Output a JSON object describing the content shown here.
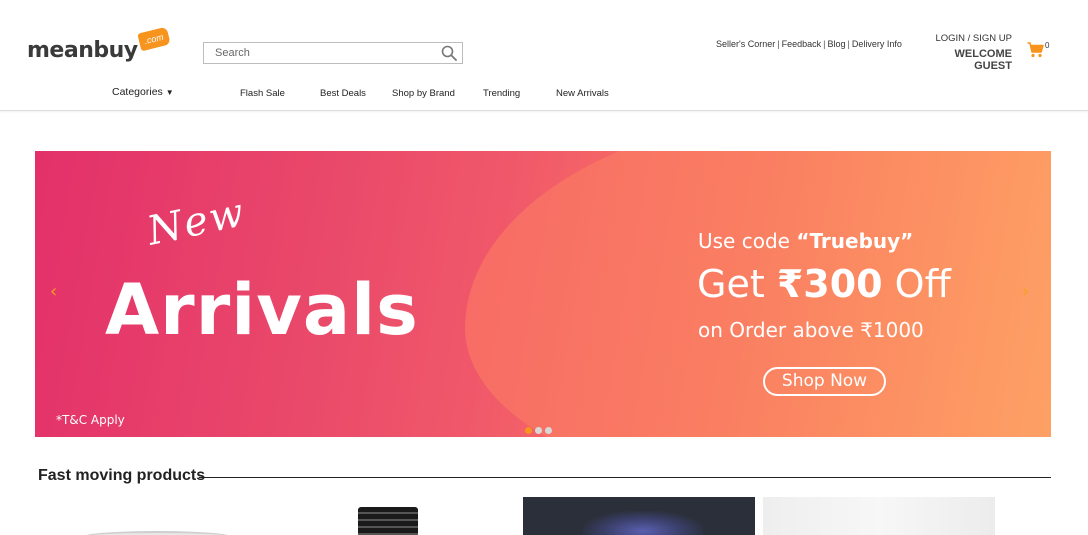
{
  "header": {
    "logo": {
      "word": "meanbuy",
      "tag": ".com"
    },
    "search": {
      "placeholder": "Search"
    },
    "top_links": [
      "Seller's Corner",
      "Feedback",
      "Blog",
      "Delivery Info"
    ],
    "login": {
      "link": "LOGIN / SIGN UP",
      "welcome": "WELCOME GUEST"
    },
    "cart": {
      "count": "0"
    }
  },
  "nav": {
    "categories": "Categories",
    "items": [
      "Flash Sale",
      "Best Deals",
      "Shop by Brand",
      "Trending",
      "New Arrivals"
    ]
  },
  "banner": {
    "script": "New",
    "headline": "Arrivals",
    "code_prefix": "Use code ",
    "code": "“Truebuy”",
    "get_prefix": "Get ",
    "get_amount": "₹300",
    "get_suffix": " Off",
    "order": "on Order above ₹1000",
    "cta": "Shop Now",
    "terms": "*T&C Apply",
    "prev": "‹",
    "next": "›",
    "slides": 3,
    "active_slide": 0
  },
  "section": {
    "title": "Fast moving products"
  },
  "colors": {
    "accent": "#f7941d",
    "banner_start": "#e3306a",
    "banner_end": "#fda866"
  }
}
